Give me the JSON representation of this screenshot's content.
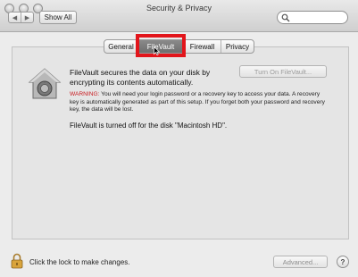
{
  "window": {
    "title": "Security & Privacy"
  },
  "toolbar": {
    "back_glyph": "◀",
    "forward_glyph": "▶",
    "show_all_label": "Show All",
    "search": {
      "value": "",
      "placeholder": ""
    }
  },
  "tabs": {
    "general": "General",
    "filevault": "FileVault",
    "firewall": "Firewall",
    "privacy": "Privacy",
    "selected": "FileVault"
  },
  "filevault": {
    "description": "FileVault secures the data on your disk by encrypting its contents automatically.",
    "turn_on_label": "Turn On FileVault...",
    "warning_label": "WARNING:",
    "warning_text": " You will need your login password or a recovery key to access your data. A recovery key is automatically generated as part of this setup. If you forget both your password and recovery key, the data will be lost.",
    "status": "FileVault is turned off for the disk \"Macintosh HD\"."
  },
  "footer": {
    "lock_message": "Click the lock to make changes.",
    "advanced_label": "Advanced...",
    "help_label": "?"
  },
  "icons": {
    "filevault": "house-safe-icon",
    "lock": "padlock-icon",
    "search": "search-icon"
  },
  "colors": {
    "highlight": "#e2151b",
    "warning": "#c8191e",
    "selected_tab": "#7a7a7a"
  }
}
